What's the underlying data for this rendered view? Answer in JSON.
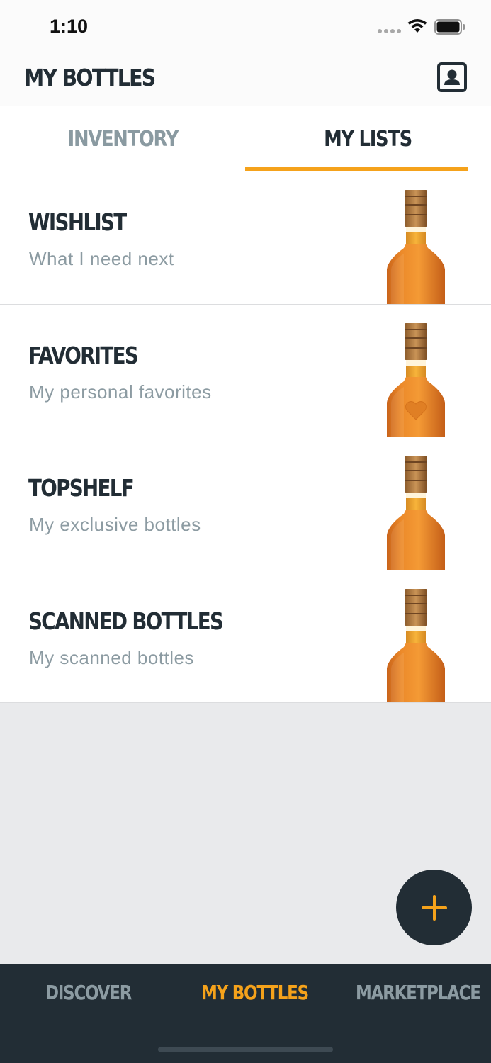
{
  "status_bar": {
    "time": "1:10"
  },
  "header": {
    "title": "MY BOTTLES",
    "profile_icon": "profile-card-icon"
  },
  "tabs": [
    {
      "label": "INVENTORY",
      "active": false
    },
    {
      "label": "MY LISTS",
      "active": true
    }
  ],
  "lists": [
    {
      "title": "WISHLIST",
      "subtitle": "What I need next",
      "bottle_icon": "bottle-icon"
    },
    {
      "title": "FAVORITES",
      "subtitle": "My personal favorites",
      "bottle_icon": "bottle-heart-icon"
    },
    {
      "title": "TOPSHELF",
      "subtitle": "My exclusive bottles",
      "bottle_icon": "bottle-icon"
    },
    {
      "title": "SCANNED BOTTLES",
      "subtitle": "My scanned bottles",
      "bottle_icon": "bottle-icon"
    }
  ],
  "fab": {
    "icon": "plus-icon"
  },
  "bottom_nav": [
    {
      "label": "DISCOVER",
      "active": false
    },
    {
      "label": "MY BOTTLES",
      "active": true
    },
    {
      "label": "MARKETPLACE",
      "active": false
    }
  ],
  "colors": {
    "accent": "#f5a21b",
    "dark": "#222d35",
    "muted": "#8c9ba2",
    "background": "#e9eaec"
  }
}
